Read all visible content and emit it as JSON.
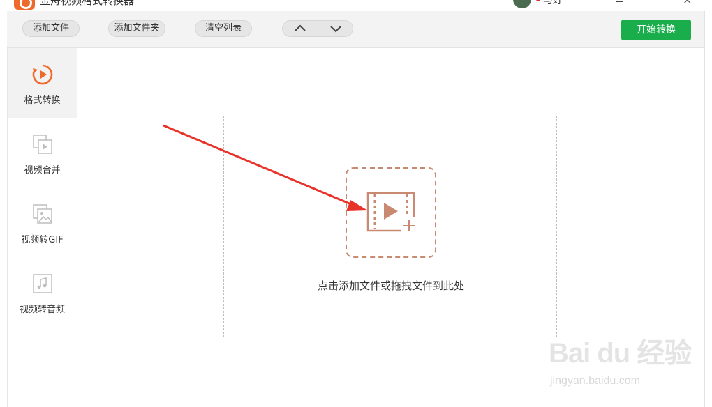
{
  "window": {
    "title": "金舟视频格式转换器",
    "user_name": "与好"
  },
  "toolbar": {
    "add_file": "添加文件",
    "add_folder": "添加文件夹",
    "clear_list": "清空列表",
    "move_up_icon": "chevron-up-icon",
    "move_down_icon": "chevron-down-icon",
    "start": "开始转换"
  },
  "sidebar": {
    "items": [
      {
        "label": "格式转换",
        "icon": "format-convert-icon",
        "active": true
      },
      {
        "label": "视频合并",
        "icon": "video-merge-icon",
        "active": false
      },
      {
        "label": "视频转GIF",
        "icon": "video-to-gif-icon",
        "active": false
      },
      {
        "label": "视频转音频",
        "icon": "video-to-audio-icon",
        "active": false
      }
    ]
  },
  "main": {
    "drop_hint": "点击添加文件或拖拽文件到此处"
  },
  "watermark": {
    "logo_text": "Bai du 经验",
    "url": "jingyan.baidu.com"
  },
  "colors": {
    "accent_orange": "#ef6a2a",
    "start_green": "#1aad4b",
    "icon_brown": "#c98a72",
    "annotation_red": "#e8332a"
  }
}
